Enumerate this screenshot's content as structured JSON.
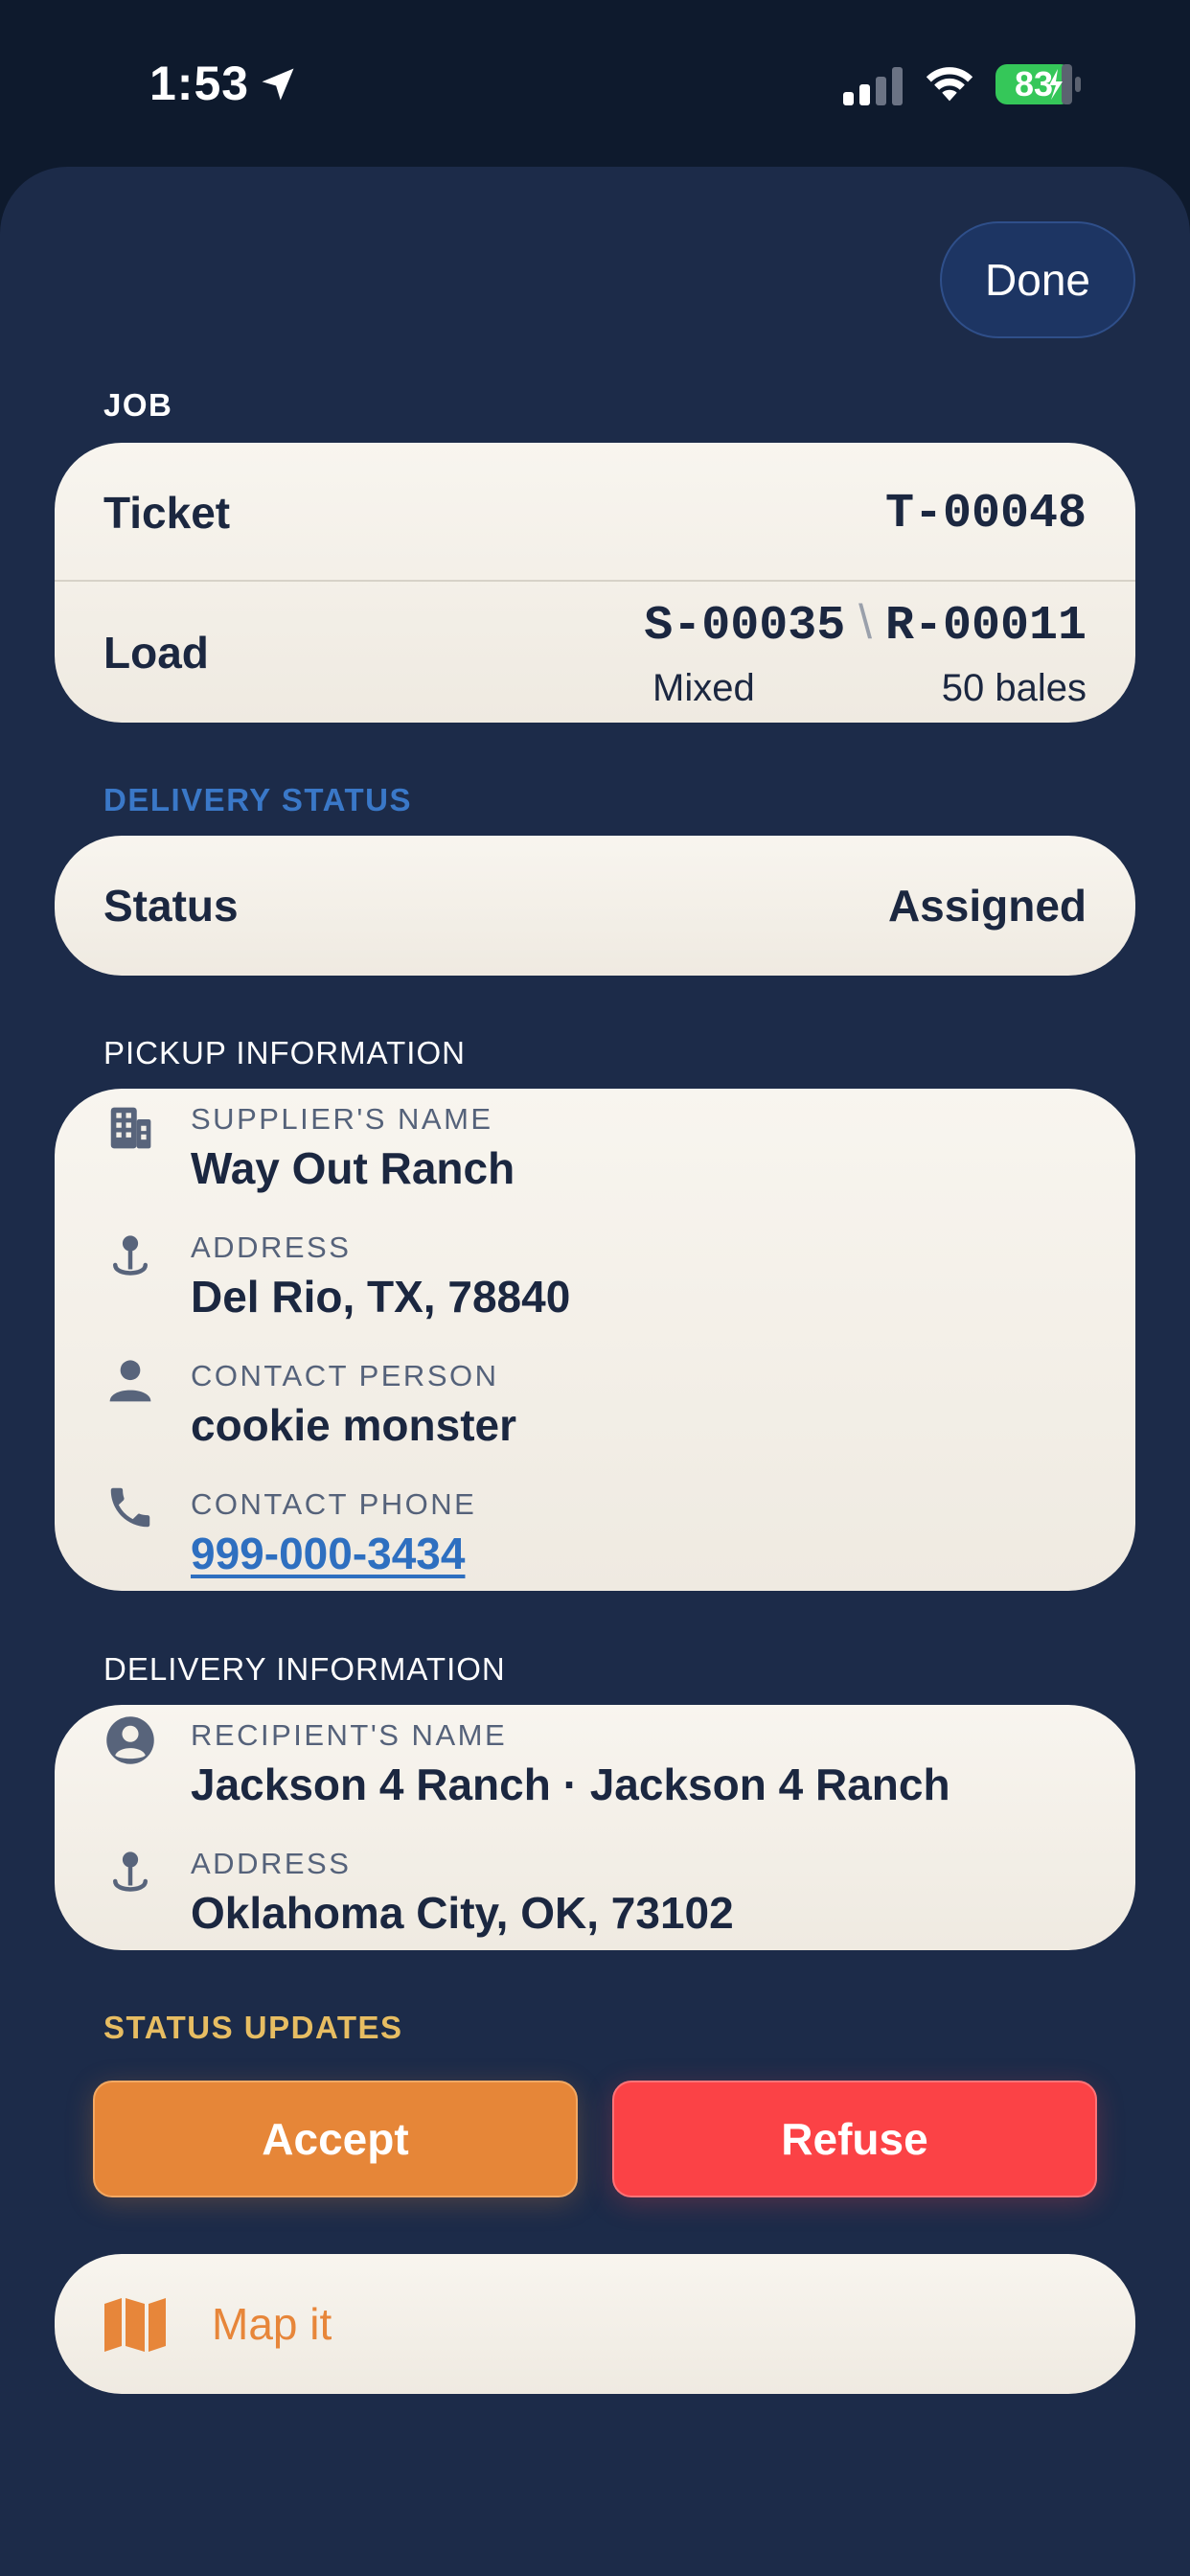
{
  "status_bar": {
    "time": "1:53",
    "battery": "83",
    "icons": [
      "location-arrow-icon",
      "cellular-signal-icon",
      "wifi-icon",
      "battery-charging-icon"
    ]
  },
  "header": {
    "done_label": "Done"
  },
  "job": {
    "section_label": "JOB",
    "ticket_label": "Ticket",
    "ticket_value": "T-00048",
    "load_label": "Load",
    "load_supplier_code": "S-00035",
    "load_separator": "\\",
    "load_receiver_code": "R-00011",
    "load_type": "Mixed",
    "load_quantity": "50 bales"
  },
  "delivery_status": {
    "section_label": "DELIVERY STATUS",
    "status_label": "Status",
    "status_value": "Assigned"
  },
  "pickup": {
    "section_label": "PICKUP INFORMATION",
    "items": [
      {
        "icon": "building-icon",
        "caption": "SUPPLIER'S NAME",
        "value": "Way Out Ranch"
      },
      {
        "icon": "map-pin-icon",
        "caption": "ADDRESS",
        "value": "Del Rio, TX, 78840"
      },
      {
        "icon": "person-icon",
        "caption": "CONTACT PERSON",
        "value": "cookie monster"
      },
      {
        "icon": "phone-icon",
        "caption": "CONTACT PHONE",
        "value": "999-000-3434"
      }
    ]
  },
  "delivery": {
    "section_label": "DELIVERY INFORMATION",
    "items": [
      {
        "icon": "person-circle-icon",
        "caption": "RECIPIENT'S NAME",
        "value": "Jackson 4 Ranch · Jackson 4 Ranch"
      },
      {
        "icon": "map-pin-icon",
        "caption": "ADDRESS",
        "value": "Oklahoma City, OK, 73102"
      }
    ]
  },
  "status_updates": {
    "section_label": "STATUS UPDATES",
    "accept_label": "Accept",
    "refuse_label": "Refuse"
  },
  "map": {
    "label": "Map it",
    "icon": "map-icon"
  },
  "colors": {
    "background": "#1c2b49",
    "card": "#f4f0e8",
    "text_dark": "#1b2740",
    "delivery_status_label": "#3a78c8",
    "status_updates_label": "#e7bd62",
    "accept": "#e68638",
    "refuse": "#fb4246",
    "map_text": "#e7863a",
    "link": "#2e6fc0",
    "battery": "#35c759"
  }
}
